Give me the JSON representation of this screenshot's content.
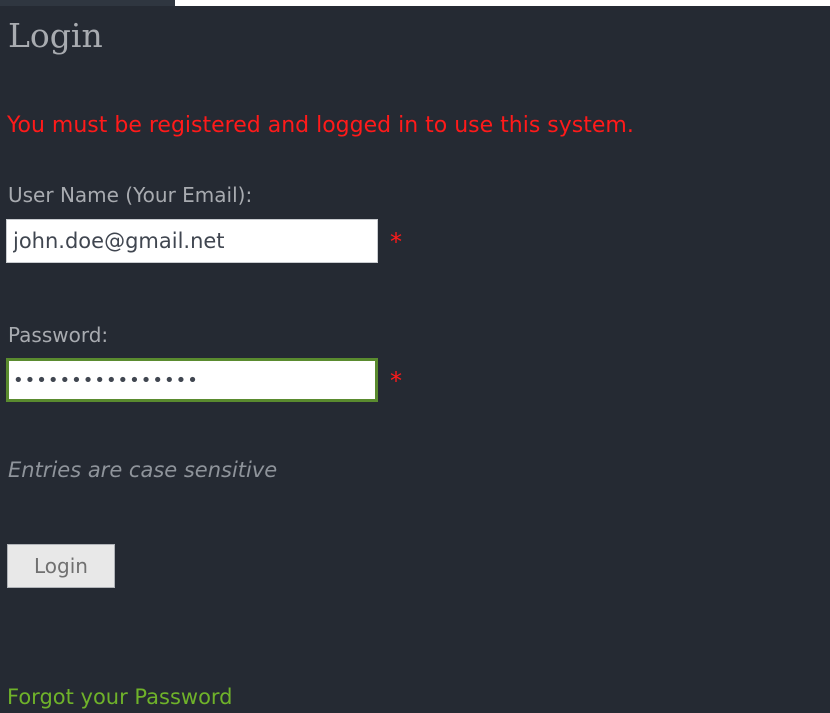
{
  "page": {
    "title": "Login",
    "warning": "You must be registered and logged in to use this system."
  },
  "form": {
    "username": {
      "label": "User Name (Your Email):",
      "value": "john.doe@gmail.net",
      "required_marker": "*"
    },
    "password": {
      "label": "Password:",
      "value": "passwordpassword",
      "required_marker": "*"
    },
    "note": "Entries are case sensitive",
    "submit_label": "Login"
  },
  "links": {
    "forgot_password": "Forgot your Password"
  },
  "colors": {
    "background": "#252a33",
    "warning": "#ff1a1a",
    "link": "#6fb22a",
    "focus_border": "#5a8b2f"
  }
}
